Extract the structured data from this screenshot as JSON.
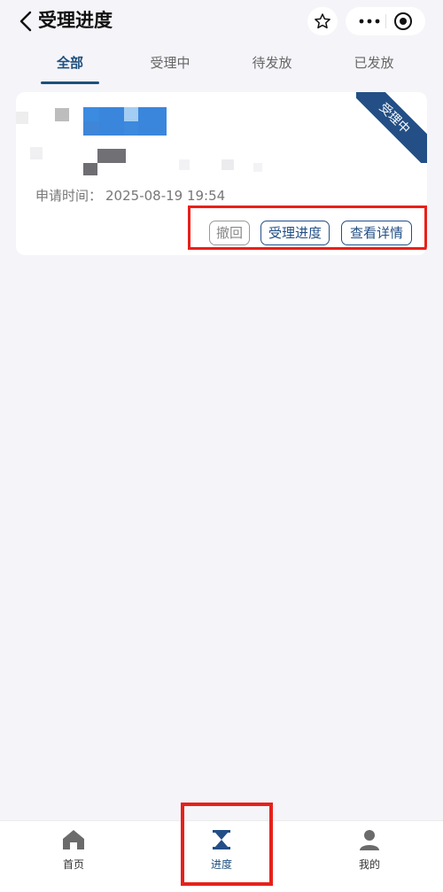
{
  "header": {
    "title": "受理进度"
  },
  "tabs": [
    {
      "label": "全部",
      "active": true
    },
    {
      "label": "受理中",
      "active": false
    },
    {
      "label": "待发放",
      "active": false
    },
    {
      "label": "已发放",
      "active": false
    }
  ],
  "card": {
    "ribbon": "受理中",
    "apply_time_label": "申请时间：",
    "apply_time_value": "2025-08-19 19:54",
    "buttons": {
      "withdraw": "撤回",
      "progress": "受理进度",
      "details": "查看详情"
    }
  },
  "tabbar": {
    "home": "首页",
    "progress": "进度",
    "mine": "我的"
  },
  "colors": {
    "accent": "#1e4f7e",
    "ribbon": "#234f86",
    "highlight": "#e8201a"
  }
}
